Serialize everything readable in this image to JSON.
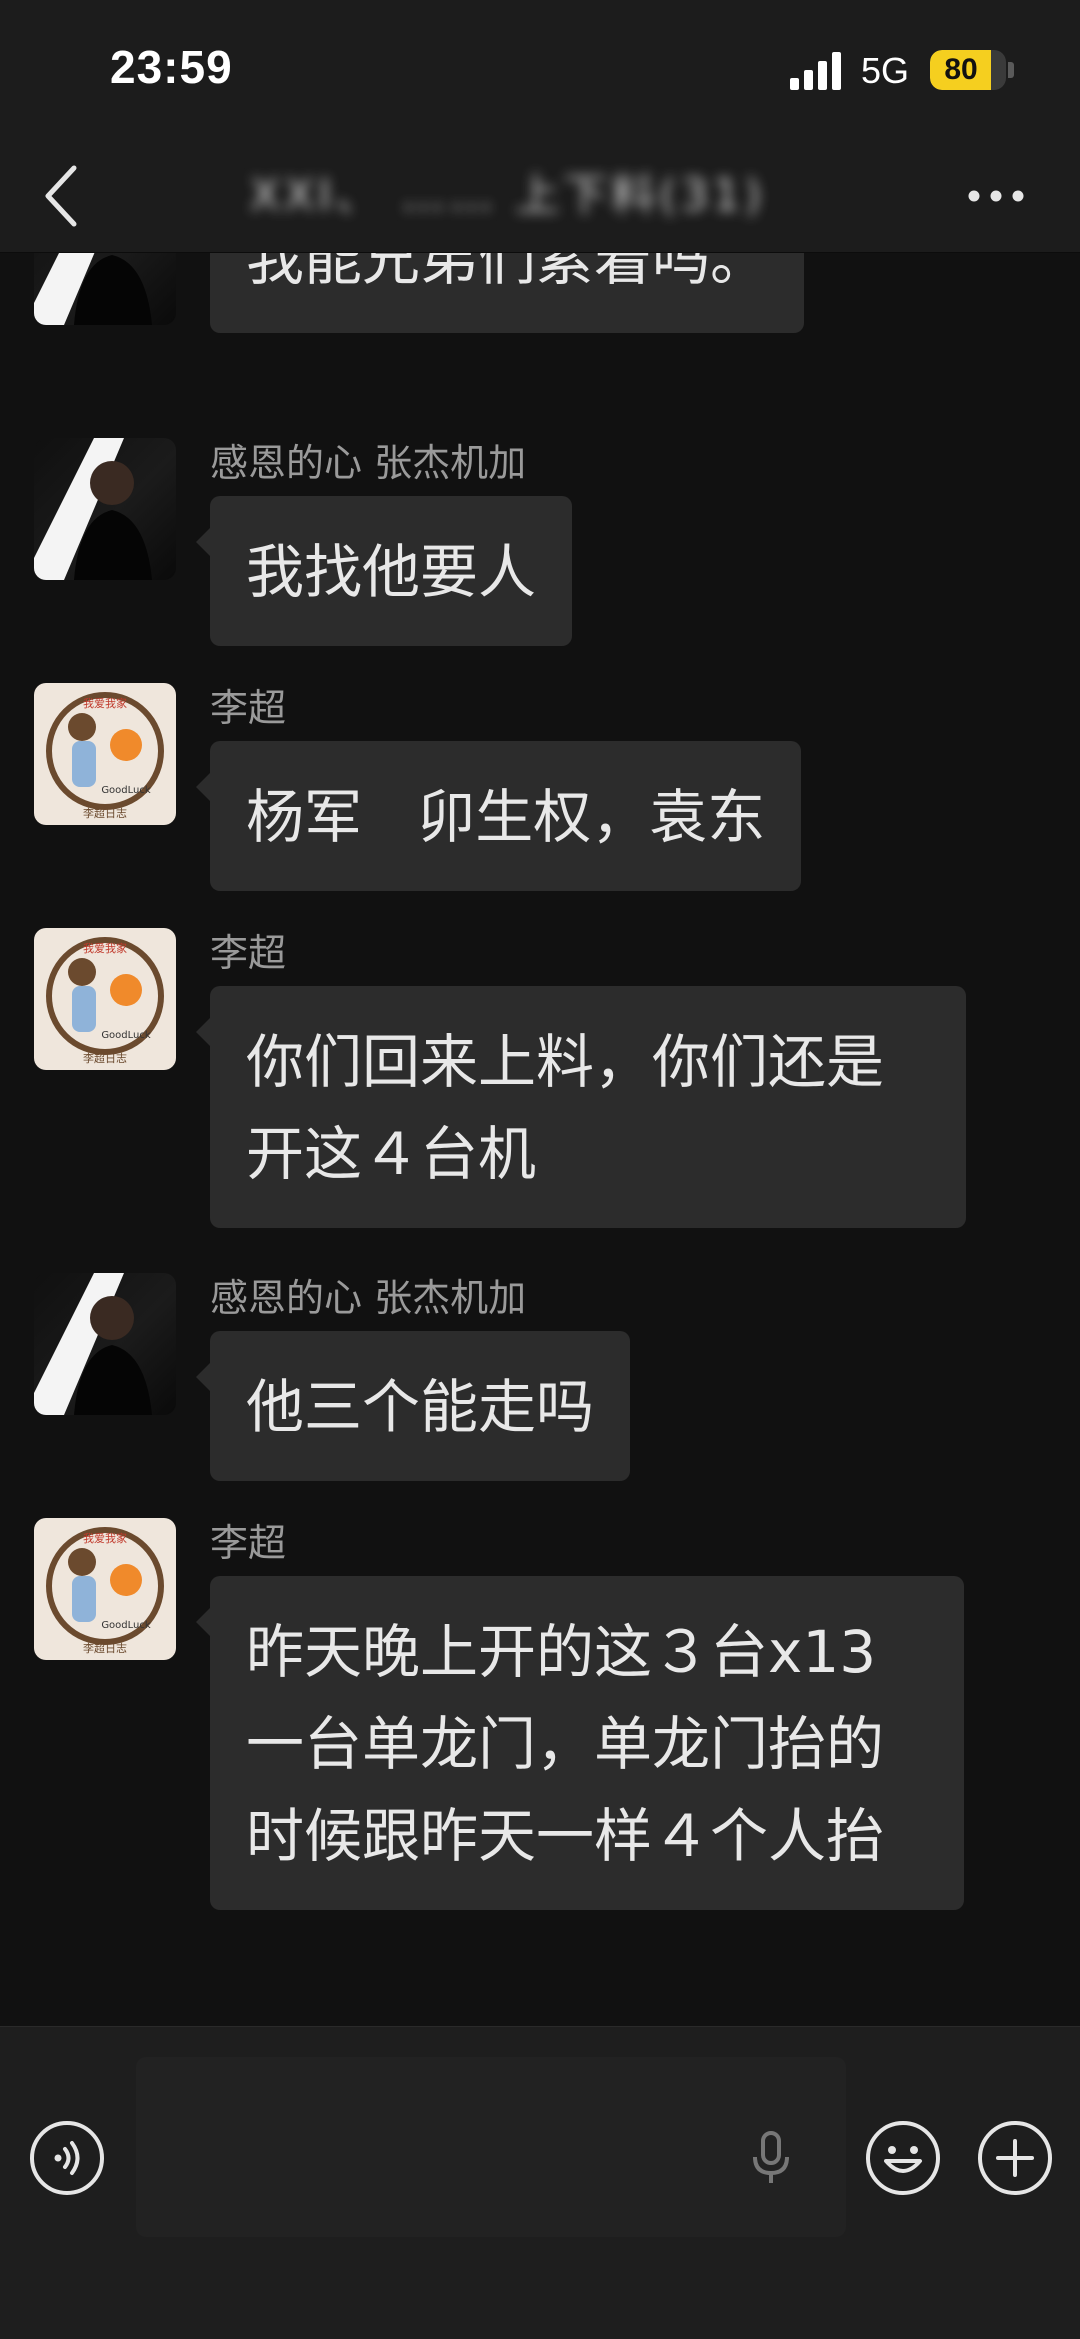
{
  "status_bar": {
    "time": "23:59",
    "network": "5G",
    "battery_level": "80",
    "battery_fraction": 0.8
  },
  "header": {
    "title": "XXI、 …… 上下料(31)"
  },
  "messages": [
    {
      "sender": "",
      "text": "我能兄弟们累着吗。",
      "avatar": "man"
    },
    {
      "sender": "感恩的心  张杰机加",
      "text": "我找他要人",
      "avatar": "man"
    },
    {
      "sender": "李超",
      "text": "杨军   卯生权，袁东",
      "avatar": "girl"
    },
    {
      "sender": "李超",
      "text": "你们回来上料，你们还是开这４台机",
      "avatar": "girl"
    },
    {
      "sender": "感恩的心  张杰机加",
      "text": "他三个能走吗",
      "avatar": "man"
    },
    {
      "sender": "李超",
      "text": "昨天晚上开的这３台x13   一台单龙门，单龙门抬的时候跟昨天一样４个人抬",
      "avatar": "girl"
    }
  ],
  "avatar_badge": {
    "top": "我爱我家",
    "bottom": "GoodLuck",
    "footer": "李超日志"
  },
  "input_bar": {
    "voice_icon": "voice-icon",
    "mic_icon": "microphone-icon",
    "emoji_icon": "emoji-icon",
    "plus_icon": "plus-icon"
  },
  "colors": {
    "background": "#111111",
    "bubble": "#2c2c2c",
    "bar": "#1c1c1c",
    "battery": "#f5cf1f"
  }
}
